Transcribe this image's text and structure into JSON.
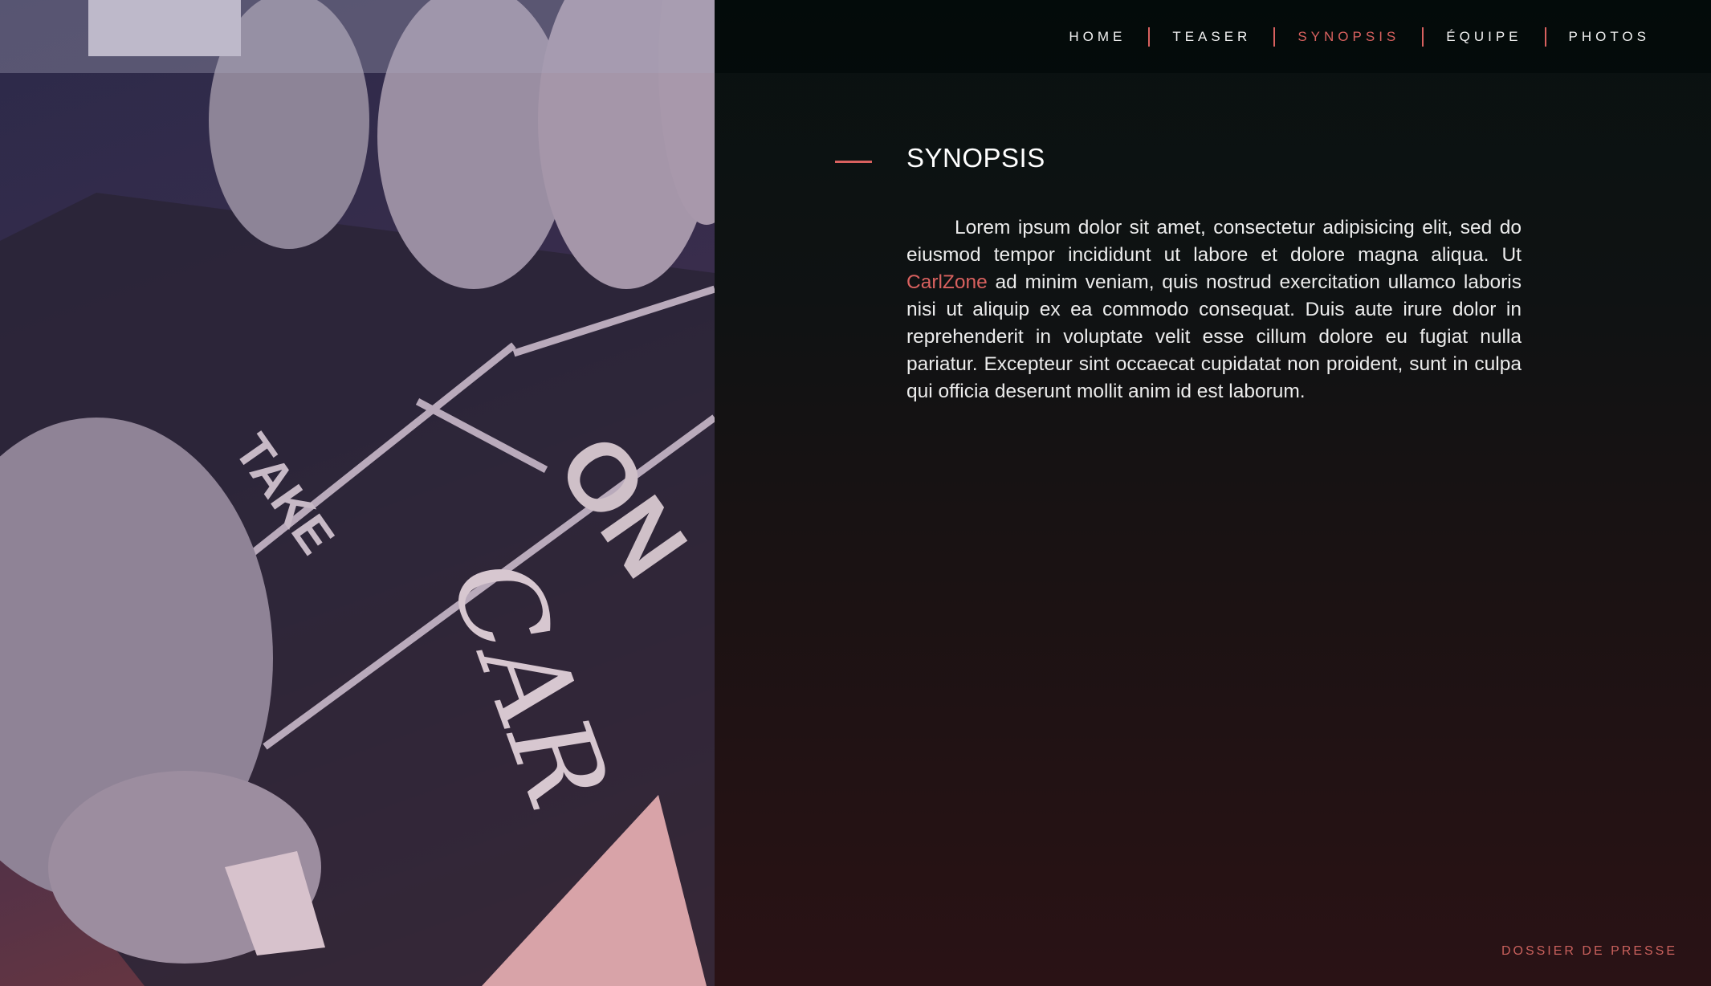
{
  "nav": {
    "items": [
      {
        "label": "HOME",
        "active": false
      },
      {
        "label": "TEASER",
        "active": false
      },
      {
        "label": "SYNOPSIS",
        "active": true
      },
      {
        "label": "ÉQUIPE",
        "active": false
      },
      {
        "label": "PHOTOS",
        "active": false
      }
    ]
  },
  "section": {
    "title": "SYNOPSIS",
    "text_before_link": "Lorem ipsum dolor sit amet, consectetur adipisicing elit, sed do eiusmod tempor incididunt ut labore et dolore magna aliqua. Ut ",
    "link_text": "CarlZone",
    "text_after_link": " ad minim veniam, quis nostrud exercitation ullamco laboris nisi ut aliquip ex ea commodo consequat. Duis aute irure dolor in reprehenderit in voluptate velit esse cillum dolore eu fugiat nulla pariatur. Excepteur sint occaecat cupidatat non proident, sunt in culpa qui officia deserunt mollit anim id est laborum."
  },
  "photo": {
    "slate_text_take": "TAKE",
    "slate_text_on": "ON",
    "chalk_text": "CAR"
  },
  "footer": {
    "label": "DOSSIER DE PRESSE"
  },
  "colors": {
    "accent": "#d9615f"
  }
}
